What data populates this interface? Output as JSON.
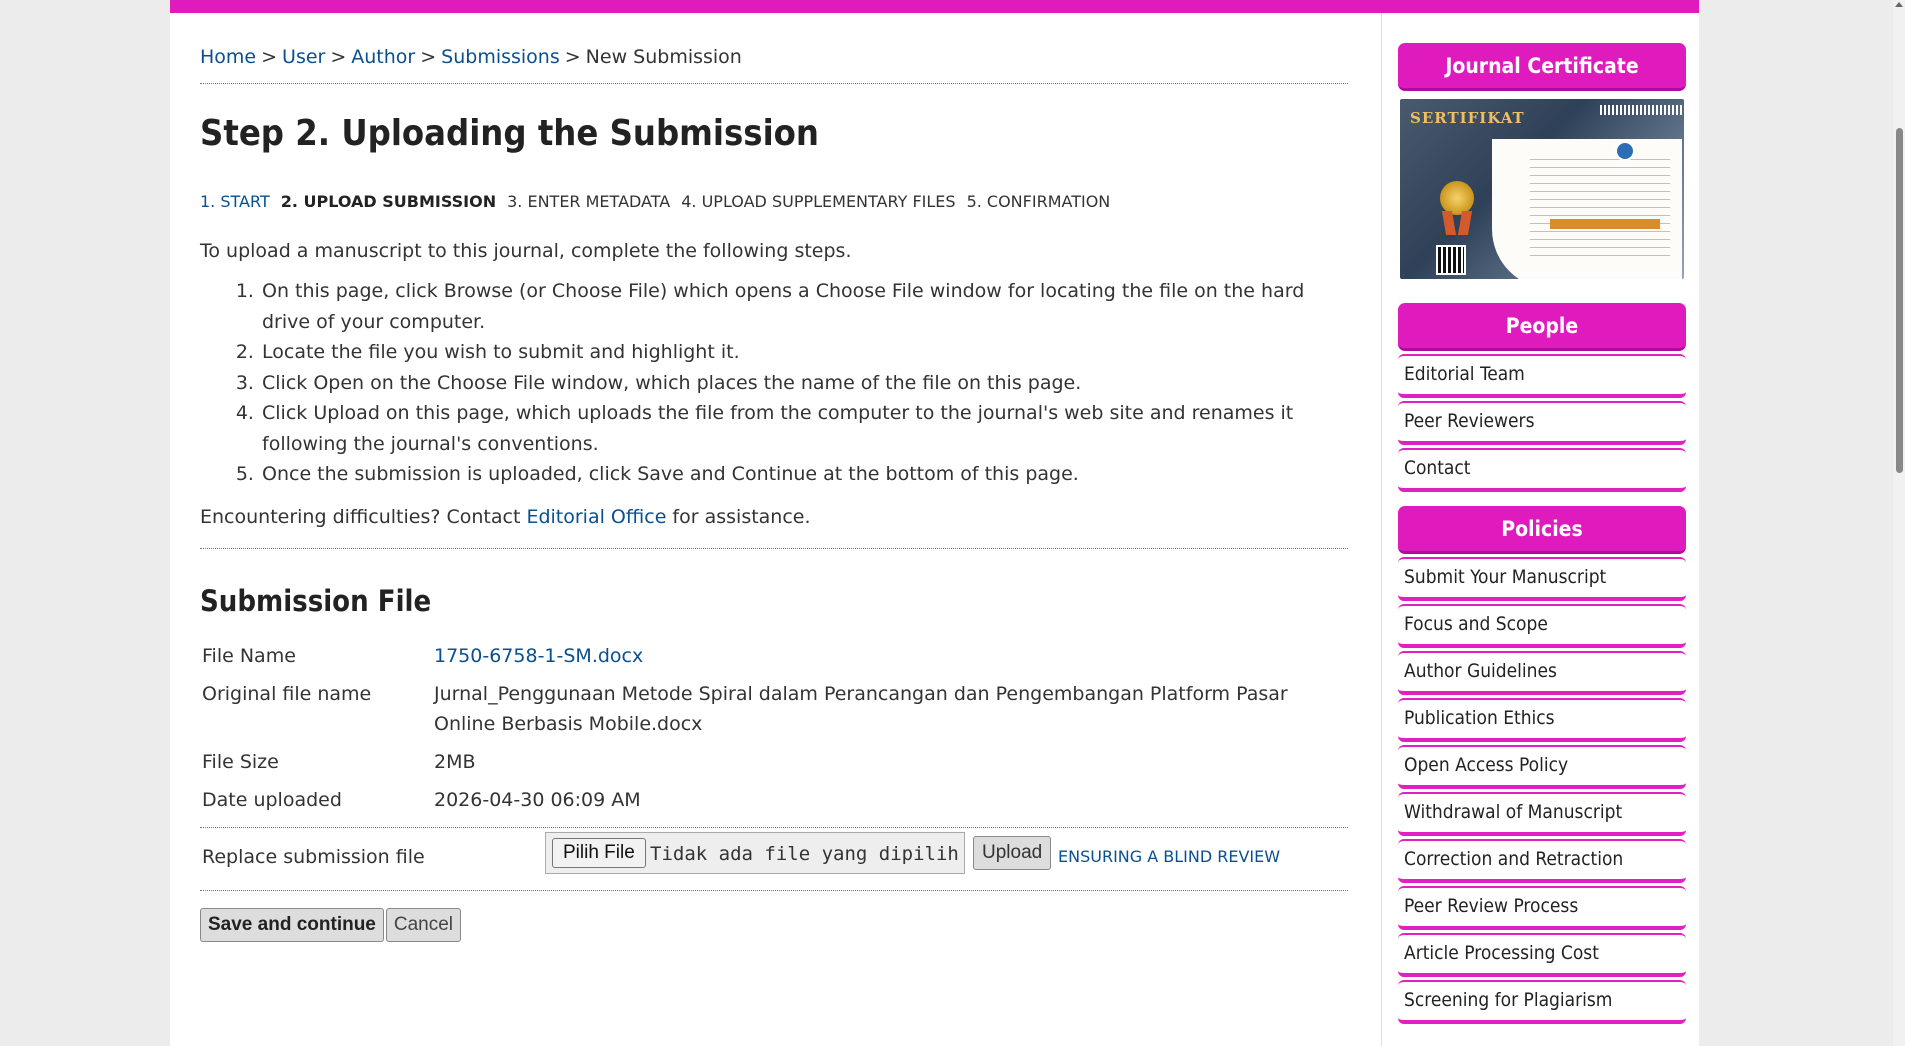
{
  "colors": {
    "accent": "#e01bbd",
    "link": "#0a4f8f"
  },
  "breadcrumb": {
    "items": [
      {
        "label": "Home"
      },
      {
        "label": "User"
      },
      {
        "label": "Author"
      },
      {
        "label": "Submissions"
      },
      {
        "label": "New Submission"
      }
    ],
    "separator": ">"
  },
  "main": {
    "title": "Step 2. Uploading the Submission",
    "steps": [
      {
        "label": "1. START"
      },
      {
        "label": "2. UPLOAD SUBMISSION"
      },
      {
        "label": "3. ENTER METADATA"
      },
      {
        "label": "4. UPLOAD SUPPLEMENTARY FILES"
      },
      {
        "label": "5. CONFIRMATION"
      }
    ],
    "intro": "To upload a manuscript to this journal, complete the following steps.",
    "instructions": [
      "On this page, click Browse (or Choose File) which opens a Choose File window for locating the file on the hard drive of your computer.",
      "Locate the file you wish to submit and highlight it.",
      "Click Open on the Choose File window, which places the name of the file on this page.",
      "Click Upload on this page, which uploads the file from the computer to the journal's web site and renames it following the journal's conventions.",
      "Once the submission is uploaded, click Save and Continue at the bottom of this page."
    ],
    "help": {
      "before": "Encountering difficulties? Contact ",
      "link": "Editorial Office",
      "after": " for assistance."
    },
    "section_title": "Submission File",
    "file": {
      "name_label": "File Name",
      "name_value": "1750-6758-1-SM.docx",
      "original_label": "Original file name",
      "original_value": "Jurnal_Penggunaan Metode Spiral dalam Perancangan dan Pengembangan Platform Pasar Online Berbasis Mobile.docx",
      "size_label": "File Size",
      "size_value": "2MB",
      "date_label": "Date uploaded",
      "date_value": "2026-04-30 06:09 AM"
    },
    "replace": {
      "label": "Replace submission file",
      "choose_button": "Pilih File",
      "no_file_text": "Tidak ada file yang dipilih",
      "upload_button": "Upload",
      "blind_review_link": "ENSURING A BLIND REVIEW"
    },
    "actions": {
      "save": "Save and continue",
      "cancel": "Cancel"
    }
  },
  "sidebar": {
    "certificate_header": "Journal Certificate",
    "certificate_image_text": "SERTIFIKAT",
    "people_header": "People",
    "people_items": [
      {
        "label": "Editorial Team"
      },
      {
        "label": "Peer Reviewers"
      },
      {
        "label": "Contact"
      }
    ],
    "policies_header": "Policies",
    "policies_items": [
      {
        "label": "Submit Your Manuscript"
      },
      {
        "label": "Focus and Scope"
      },
      {
        "label": "Author Guidelines"
      },
      {
        "label": "Publication Ethics"
      },
      {
        "label": "Open Access Policy"
      },
      {
        "label": "Withdrawal of Manuscript"
      },
      {
        "label": "Correction and Retraction"
      },
      {
        "label": "Peer Review Process"
      },
      {
        "label": "Article Processing Cost"
      },
      {
        "label": "Screening for Plagiarism"
      }
    ]
  }
}
